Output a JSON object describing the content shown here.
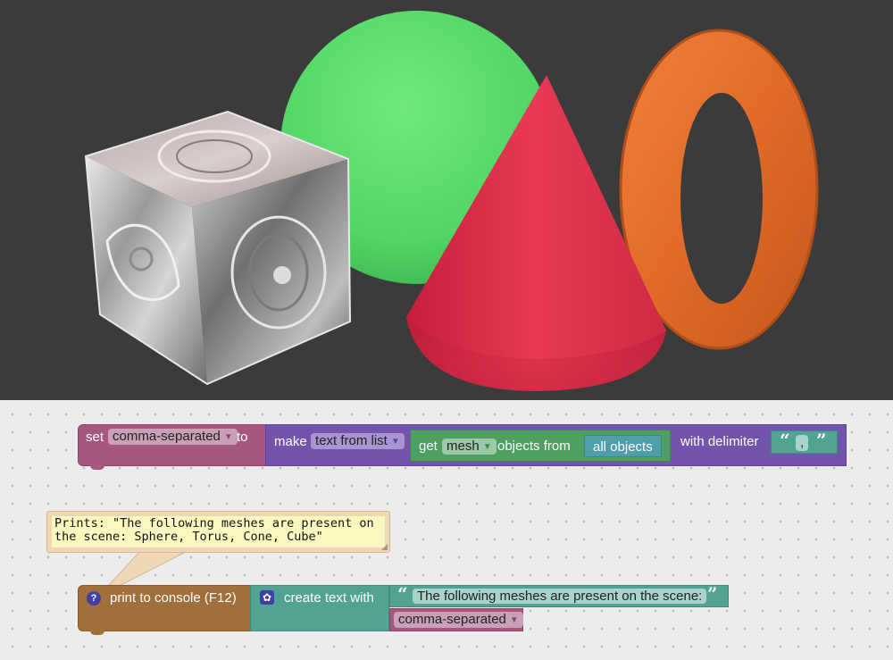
{
  "colors": {
    "viewport_bg": "#3b3b3b",
    "variables_block": "#a5577f",
    "lists_block": "#7254ad",
    "mesh_block": "#4f9e62",
    "text_block": "#53a393",
    "console_block": "#a06f3b",
    "comment_bg": "#fbf8bf",
    "comment_border": "#d8b58f"
  },
  "scene": {
    "objects": [
      "chrome-cube",
      "green-sphere",
      "red-cone",
      "orange-torus"
    ]
  },
  "blocks": {
    "set_block": {
      "set_label": "set",
      "variable": "comma-separated",
      "to_label": "to"
    },
    "make_block": {
      "make_label": "make",
      "mode": "text from list"
    },
    "get_block": {
      "get_label": "get",
      "type": "mesh",
      "objects_from_label": "objects from"
    },
    "all_objects_block": {
      "label": "all objects"
    },
    "delimiter": {
      "with_delimiter_label": "with delimiter",
      "open_quote": "“",
      "value": ",",
      "close_quote": "”"
    },
    "print_block": {
      "help_icon": "?",
      "label": "print to console (F12)"
    },
    "create_text_block": {
      "label": "create text with"
    },
    "text_string": {
      "open_quote": "“",
      "value": "The following meshes are present on the scene: ",
      "close_quote": "”"
    },
    "variable_get": {
      "variable": "comma-separated"
    }
  },
  "comment": {
    "text": "Prints: \"The following meshes are present on\nthe scene: Sphere, Torus, Cone, Cube\""
  }
}
